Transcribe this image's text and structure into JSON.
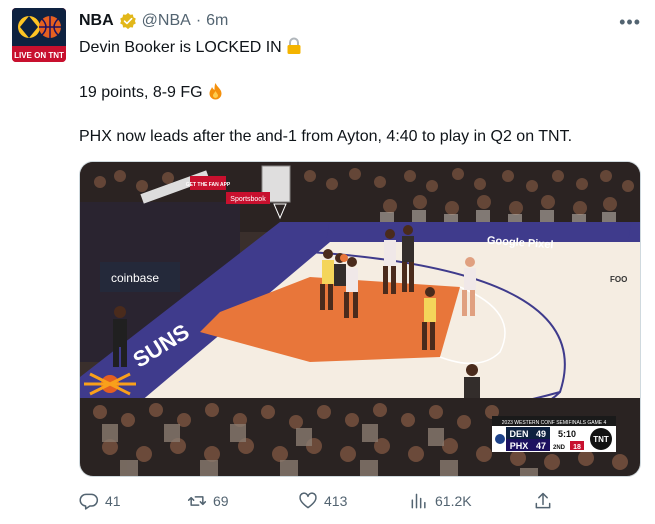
{
  "tweet": {
    "author_name": "NBA",
    "handle": "@NBA",
    "separator": "·",
    "time": "6m",
    "avatar_text": "LIVE ON TNT",
    "text_line1": "Devin Booker is LOCKED IN",
    "text_line2": "19 points, 8-9 FG",
    "text_line3": "PHX now leads after the and-1 from Ayton, 4:40 to play in Q2 on TNT."
  },
  "media": {
    "court_logo_left": "SUNS",
    "courtside_sponsor": "coinbase",
    "baseline_sponsor": "Google Pixel",
    "top_sign": "GET THE FAN APP",
    "arena_banner": "Sportsbook",
    "scorebug": {
      "header": "2023 WESTERN CONF SEMIFINALS GAME 4",
      "team1": "DEN",
      "score1": "49",
      "team2": "PHX",
      "score2": "47",
      "clock": "5:10",
      "period": "2ND",
      "shot_clock": "18",
      "network": "TNT"
    }
  },
  "actions": {
    "replies": "41",
    "retweets": "69",
    "likes": "413",
    "views": "61.2K"
  },
  "colors": {
    "accent_gray": "#536471",
    "verified_gold": "#e2b719",
    "court_orange": "#e8763a",
    "court_purple": "#3f3b8c",
    "tnt_red": "#c8102e"
  }
}
